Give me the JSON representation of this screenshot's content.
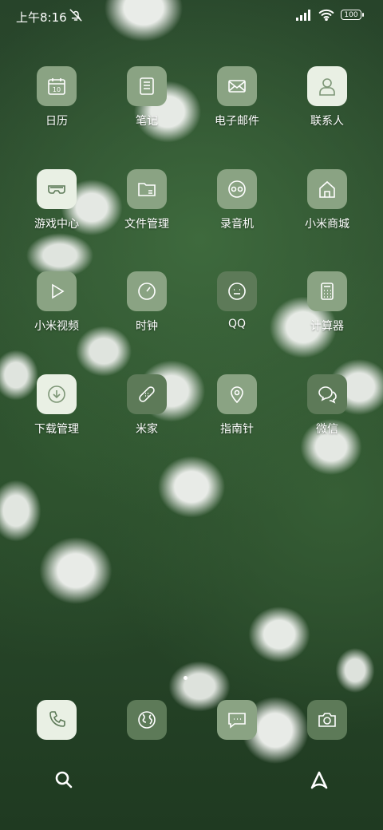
{
  "status": {
    "time": "上午8:16",
    "battery": "100"
  },
  "apps": [
    {
      "label": "日历",
      "icon": "calendar-icon",
      "date": "10"
    },
    {
      "label": "笔记",
      "icon": "notes-icon"
    },
    {
      "label": "电子邮件",
      "icon": "mail-icon"
    },
    {
      "label": "联系人",
      "icon": "contact-icon"
    },
    {
      "label": "游戏中心",
      "icon": "vr-headset-icon"
    },
    {
      "label": "文件管理",
      "icon": "folder-icon"
    },
    {
      "label": "录音机",
      "icon": "tape-recorder-icon"
    },
    {
      "label": "小米商城",
      "icon": "home-store-icon"
    },
    {
      "label": "小米视频",
      "icon": "play-icon"
    },
    {
      "label": "时钟",
      "icon": "clock-icon"
    },
    {
      "label": "QQ",
      "icon": "smiley-icon"
    },
    {
      "label": "计算器",
      "icon": "calculator-icon"
    },
    {
      "label": "下载管理",
      "icon": "download-icon"
    },
    {
      "label": "米家",
      "icon": "bandage-icon"
    },
    {
      "label": "指南针",
      "icon": "location-pin-icon"
    },
    {
      "label": "微信",
      "icon": "chat-bubbles-icon"
    }
  ],
  "dock": [
    {
      "name": "phone-icon"
    },
    {
      "name": "browser-globe-icon"
    },
    {
      "name": "messages-icon"
    },
    {
      "name": "camera-icon"
    }
  ],
  "colors": {
    "tile_mid": "#8aa383",
    "tile_light": "#e9f0e4",
    "tile_dark": "#5d7a58"
  }
}
